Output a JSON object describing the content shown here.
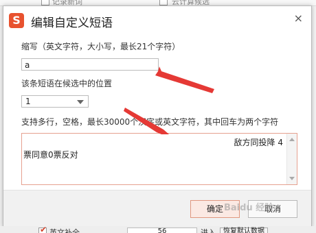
{
  "background": {
    "top_items": [
      "记录新词",
      "云计算候选"
    ],
    "bottom": {
      "checkbox_label": "英文补全",
      "value": "56",
      "suffix": "进入",
      "button": "恢复默认数据"
    }
  },
  "dialog": {
    "logo_char": "S",
    "title": "编辑自定义短语",
    "close_symbol": "×",
    "abbr_label": "缩写（英文字符，大小写，最长21个字符）",
    "abbr_value": "a",
    "position_label": "该条短语在候选中的位置",
    "position_value": "1",
    "content_label": "支持多行，空格，最长30000个汉字或英文字符，其中回车为两个字符",
    "content_line1": "敌方同投降 4",
    "content_line2": "票同意0票反对",
    "ok_label": "确定",
    "cancel_label": "取消"
  },
  "watermark": "Baidu 经验",
  "colors": {
    "brand": "#e8522f",
    "annotation_arrow": "#e53935",
    "textarea_border": "#e6a08f"
  }
}
